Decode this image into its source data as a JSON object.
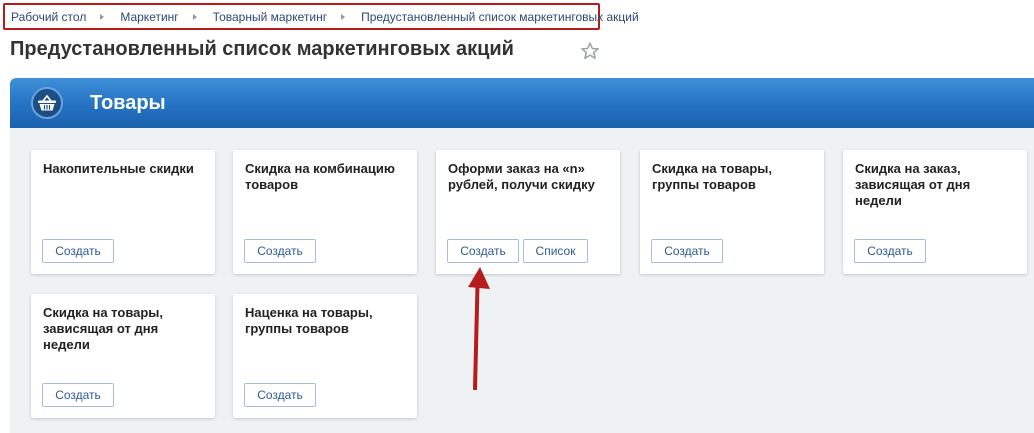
{
  "breadcrumb": {
    "items": [
      "Рабочий стол",
      "Маркетинг",
      "Товарный маркетинг",
      "Предустановленный список маркетинговых акций"
    ]
  },
  "page": {
    "title": "Предустановленный список маркетинговых акций"
  },
  "section": {
    "title": "Товары",
    "icon": "basket-icon"
  },
  "cards": [
    {
      "title": "Накопительные скидки",
      "buttons": [
        "Создать"
      ]
    },
    {
      "title": "Скидка на комбинацию товаров",
      "buttons": [
        "Создать"
      ]
    },
    {
      "title": "Оформи заказ на «n» рублей, получи скидку",
      "buttons": [
        "Создать",
        "Список"
      ]
    },
    {
      "title": "Скидка на товары, группы товаров",
      "buttons": [
        "Создать"
      ]
    },
    {
      "title": "Скидка на заказ, зависящая от дня недели",
      "buttons": [
        "Создать"
      ]
    },
    {
      "title": "Скидка на товары, зависящая от дня недели",
      "buttons": [
        "Создать"
      ]
    },
    {
      "title": "Наценка на товары, группы товаров",
      "buttons": [
        "Создать"
      ]
    }
  ],
  "colors": {
    "annotation": "#b71c1c",
    "header_blue": "#2572c4",
    "link": "#2c5b92"
  }
}
